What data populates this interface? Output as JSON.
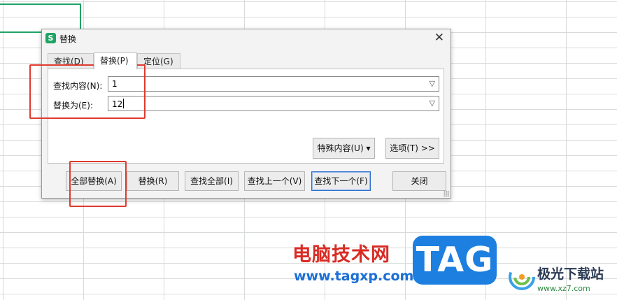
{
  "dialog": {
    "title": "替换",
    "app_icon": "S",
    "close_glyph": "✕"
  },
  "tabs": [
    {
      "label": "查找(D)"
    },
    {
      "label": "替换(P)",
      "active": true
    },
    {
      "label": "定位(G)"
    }
  ],
  "find": {
    "label": "查找内容(N):",
    "value": "1"
  },
  "replace": {
    "label": "替换为(E):",
    "value": "12"
  },
  "panel_buttons": {
    "special": "特殊内容(U) ▾",
    "options": "选项(T) >>"
  },
  "actions": {
    "replace_all": "全部替换(A)",
    "replace": "替换(R)",
    "find_all": "查找全部(I)",
    "find_prev": "查找上一个(V)",
    "find_next": "查找下一个(F)",
    "close": "关闭"
  },
  "dropdown_icon": "chevron-down-icon",
  "watermark": {
    "cn": "电脑技术网",
    "url": "www.tagxp.com",
    "tag": "TAG",
    "site_name": "极光下载站",
    "site_url": "www.xz7.com"
  },
  "colors": {
    "highlight": "#e03a2f",
    "selection": "#21a366",
    "tag_bg": "#1d7fe0"
  }
}
